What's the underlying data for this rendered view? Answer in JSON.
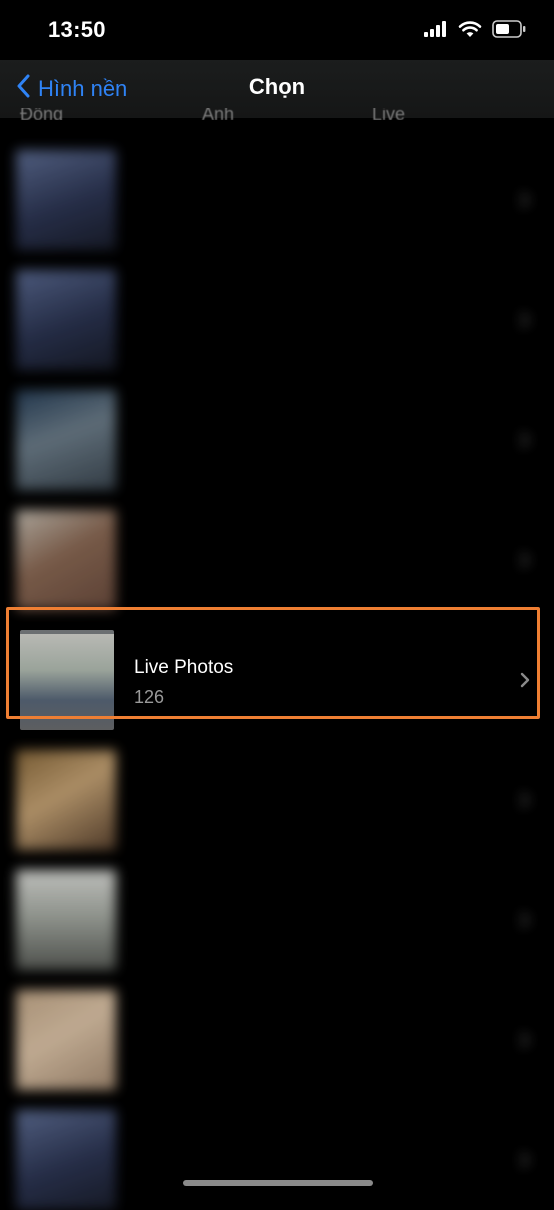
{
  "status_bar": {
    "time": "13:50",
    "icons": [
      "cellular-signal-icon",
      "wifi-icon",
      "battery-icon"
    ]
  },
  "nav": {
    "back_label": "Hình nền",
    "title": "Chọn",
    "cutoff_tabs": [
      "Động",
      "Ảnh",
      "Live"
    ]
  },
  "colors": {
    "accent": "#2f83f5",
    "highlight_border": "#ef7f33",
    "background": "#000000",
    "secondary_text": "#9a9a9a"
  },
  "albums": [
    {
      "title": "",
      "count": "",
      "blurred": true
    },
    {
      "title": "",
      "count": "",
      "blurred": true
    },
    {
      "title": "",
      "count": "",
      "blurred": true
    },
    {
      "title": "",
      "count": "",
      "blurred": true
    },
    {
      "title": "Live Photos",
      "count": "126",
      "blurred": false,
      "highlighted": true
    },
    {
      "title": "",
      "count": "",
      "blurred": true
    },
    {
      "title": "",
      "count": "",
      "blurred": true
    },
    {
      "title": "",
      "count": "",
      "blurred": true
    },
    {
      "title": "",
      "count": "",
      "blurred": true
    }
  ]
}
